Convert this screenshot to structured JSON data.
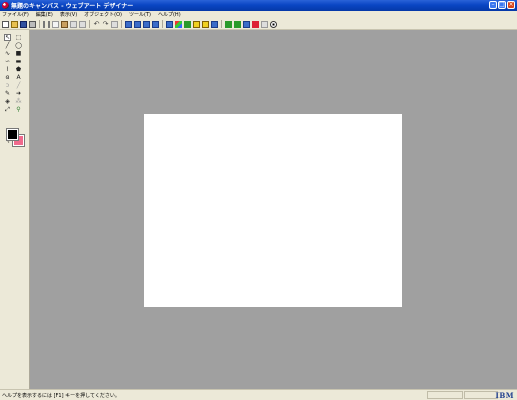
{
  "window": {
    "title": "無題のキャンバス - ウェブアート デザイナー",
    "minimize": "–",
    "maximize": "□",
    "close": "×"
  },
  "menu": {
    "items": [
      {
        "label": "ファイル(F)"
      },
      {
        "label": "編集(E)"
      },
      {
        "label": "表示(V)"
      },
      {
        "label": "オブジェクト(O)"
      },
      {
        "label": "ツール(T)"
      },
      {
        "label": "ヘルプ(H)"
      }
    ]
  },
  "toolbar": {
    "undo": "↶",
    "redo": "↷"
  },
  "tools": {
    "text_tool": "A",
    "swap": "↰"
  },
  "colors": {
    "foreground": "#000000",
    "background": "#f06a8c",
    "workspace": "#a0a0a0",
    "canvas": "#ffffff"
  },
  "status": {
    "help_text": "ヘルプを表示するには [F1] キーを押してください。",
    "logo": "IBM"
  }
}
